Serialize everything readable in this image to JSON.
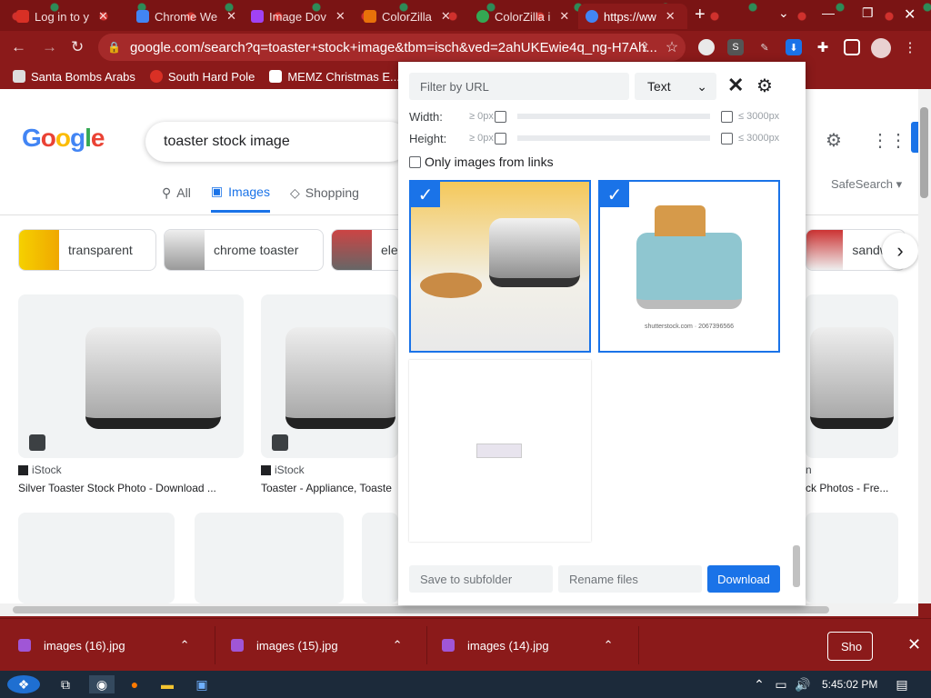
{
  "browser": {
    "tabs": [
      {
        "label": "Log in to y",
        "icon": "gmail-icon",
        "color": "#d93025"
      },
      {
        "label": "Chrome We",
        "icon": "chrome-webstore-icon",
        "color": "#4285f4"
      },
      {
        "label": "Image Dov",
        "icon": "image-downloader-icon",
        "color": "#a142f4"
      },
      {
        "label": "ColorZilla",
        "icon": "colorzilla-icon",
        "color": "#e8710a"
      },
      {
        "label": "ColorZilla i",
        "icon": "colorzilla-icon",
        "color": "#34a853"
      },
      {
        "label": "https://ww",
        "icon": "google-icon",
        "color": "#4285f4",
        "active": true
      }
    ],
    "url": "google.com/search?q=toaster+stock+image&tbm=isch&ved=2ahUKEwie4q_ng-H7Ah...",
    "bookmarks": [
      "Santa Bombs Arabs",
      "South Hard Pole",
      "MEMZ Christmas E..."
    ]
  },
  "google": {
    "query": "toaster stock image",
    "tabs": [
      "All",
      "Images",
      "Shopping"
    ],
    "active_tab": "Images",
    "safesearch": "SafeSearch",
    "chips": [
      "transparent",
      "chrome toaster",
      "ele",
      "sandwi"
    ],
    "results": [
      {
        "source": "iStock",
        "caption": "Silver Toaster Stock Photo - Download ..."
      },
      {
        "source": "iStock",
        "caption": "Toaster - Appliance, Toaste"
      },
      {
        "source": "n",
        "caption": "ck Photos - Fre..."
      }
    ]
  },
  "popup": {
    "filter_placeholder": "Filter by URL",
    "mode": "Text",
    "width_label": "Width:",
    "height_label": "Height:",
    "min_label": "≥ 0px",
    "max_label": "≤ 3000px",
    "only_links_label": "Only images from links",
    "images": [
      {
        "selected": true,
        "watermark": ""
      },
      {
        "selected": true,
        "watermark": "shutterstock.com · 2067396566"
      },
      {
        "selected": false,
        "watermark": ""
      }
    ],
    "subfolder_placeholder": "Save to subfolder",
    "rename_placeholder": "Rename files",
    "download_label": "Download"
  },
  "downloads": {
    "items": [
      "images (16).jpg",
      "images (15).jpg",
      "images (14).jpg"
    ],
    "show_all": "Sho"
  },
  "taskbar": {
    "time": "5:45:02 PM"
  },
  "colors": {
    "accent": "#1a73e8",
    "frame": "#8b1a1a"
  }
}
